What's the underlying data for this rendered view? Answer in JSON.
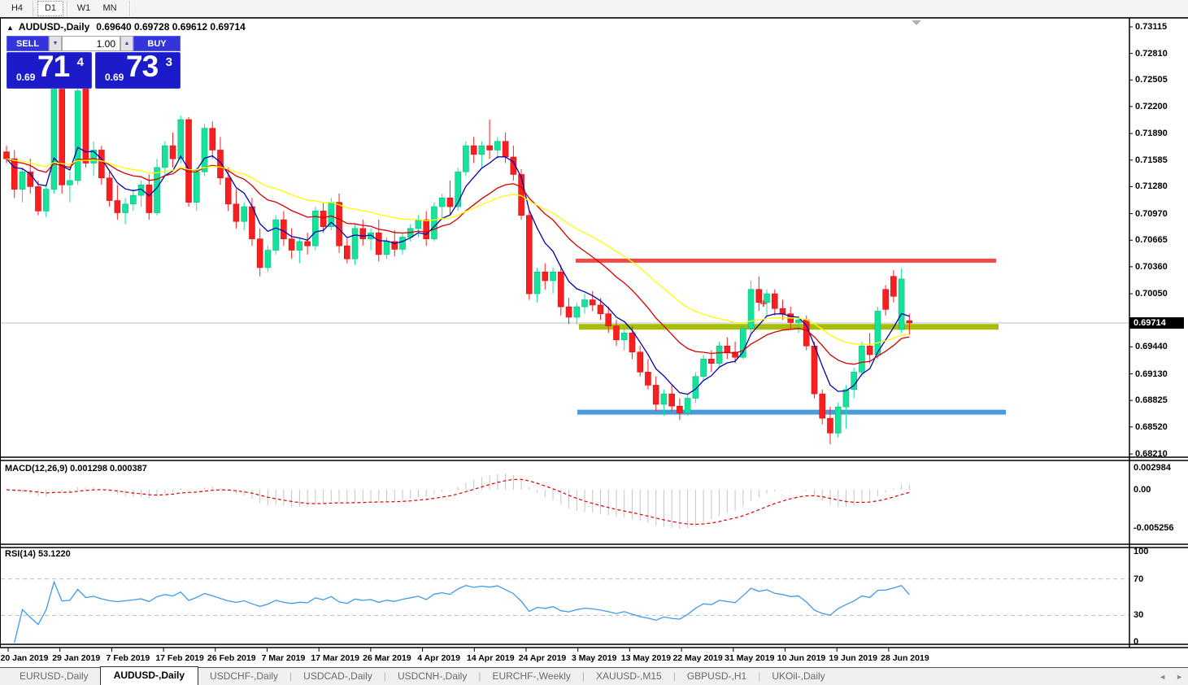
{
  "toolbar": {
    "timeframes": [
      {
        "label": "H4",
        "active": false
      },
      {
        "label": "D1",
        "active": true
      },
      {
        "label": "W1",
        "active": false
      },
      {
        "label": "MN",
        "active": false
      }
    ]
  },
  "chart_header": {
    "collapse_arrow": "▲",
    "title": "AUDUSD-,Daily",
    "ohlc": "0.69640 0.69728 0.69612 0.69714"
  },
  "trade_panel": {
    "sell_label": "SELL",
    "buy_label": "BUY",
    "volume": "1.00",
    "spin_down": "▼",
    "spin_up": "▲",
    "sell_price": {
      "small": "0.69",
      "big": "71",
      "sup": "4"
    },
    "buy_price": {
      "small": "0.69",
      "big": "73",
      "sup": "3"
    }
  },
  "price_axis": {
    "ticks": [
      {
        "label": "0.73115",
        "value": 0.73115
      },
      {
        "label": "0.72810",
        "value": 0.7281
      },
      {
        "label": "0.72505",
        "value": 0.72505
      },
      {
        "label": "0.72200",
        "value": 0.722
      },
      {
        "label": "0.71890",
        "value": 0.7189
      },
      {
        "label": "0.71585",
        "value": 0.71585
      },
      {
        "label": "0.71280",
        "value": 0.7128
      },
      {
        "label": "0.70970",
        "value": 0.7097
      },
      {
        "label": "0.70665",
        "value": 0.70665
      },
      {
        "label": "0.70360",
        "value": 0.7036
      },
      {
        "label": "0.70050",
        "value": 0.7005
      },
      {
        "label": "0.69440",
        "value": 0.6944
      },
      {
        "label": "0.69130",
        "value": 0.6913
      },
      {
        "label": "0.68825",
        "value": 0.68825
      },
      {
        "label": "0.68520",
        "value": 0.6852
      },
      {
        "label": "0.68210",
        "value": 0.6821
      }
    ],
    "current_price": "0.69714",
    "current_price_value": 0.69714
  },
  "date_axis": {
    "labels": [
      "20 Jan 2019",
      "29 Jan 2019",
      "7 Feb 2019",
      "17 Feb 2019",
      "26 Feb 2019",
      "7 Mar 2019",
      "17 Mar 2019",
      "26 Mar 2019",
      "4 Apr 2019",
      "14 Apr 2019",
      "24 Apr 2019",
      "3 May 2019",
      "13 May 2019",
      "22 May 2019",
      "31 May 2019",
      "10 Jun 2019",
      "19 Jun 2019",
      "28 Jun 2019"
    ]
  },
  "macd_panel": {
    "label": "MACD(12,26,9) 0.001298 0.000387",
    "ticks": [
      {
        "label": "0.002984",
        "value": 0.002984
      },
      {
        "label": "0.00",
        "value": 0
      },
      {
        "label": "-0.005256",
        "value": -0.005256
      }
    ]
  },
  "rsi_panel": {
    "label": "RSI(14) 53.1220",
    "ticks": [
      {
        "label": "100",
        "value": 100
      },
      {
        "label": "70",
        "value": 70
      },
      {
        "label": "30",
        "value": 30
      },
      {
        "label": "0",
        "value": 0
      }
    ]
  },
  "tabs": {
    "items": [
      {
        "label": "EURUSD-,Daily",
        "active": false
      },
      {
        "label": "AUDUSD-,Daily",
        "active": true
      },
      {
        "label": "USDCHF-,Daily",
        "active": false
      },
      {
        "label": "USDCAD-,Daily",
        "active": false
      },
      {
        "label": "USDCNH-,Daily",
        "active": false
      },
      {
        "label": "EURCHF-,Weekly",
        "active": false
      },
      {
        "label": "XAUUSD-,M15",
        "active": false
      },
      {
        "label": "GBPUSD-,H1",
        "active": false
      },
      {
        "label": "UKOil-,Daily",
        "active": false
      }
    ],
    "scroll_left": "◄",
    "scroll_right": "►"
  },
  "colors": {
    "bull": "#15e39b",
    "bull_border": "#0aba7d",
    "bear": "#f71f1f",
    "bear_border": "#d51212",
    "ma_fast": "#0000b4",
    "ma_medium": "#d40000",
    "ma_slow": "#ffff00",
    "line_resistance": "#f04a45",
    "line_pivot": "#a7bd07",
    "line_support": "#4a9bdc",
    "macd_hist": "#c4c4c4",
    "macd_signal": "#e00000",
    "rsi_line": "#3f9bea",
    "grid": "#c0c0c0",
    "marker_cross": "#e03030"
  },
  "chart_data": {
    "type": "candlestick",
    "symbol": "AUDUSD-",
    "timeframe": "Daily",
    "title": "AUDUSD-,Daily 0.69640 0.69728 0.69612 0.69714",
    "x_axis_labels": [
      "20 Jan 2019",
      "29 Jan 2019",
      "7 Feb 2019",
      "17 Feb 2019",
      "26 Feb 2019",
      "7 Mar 2019",
      "17 Mar 2019",
      "26 Mar 2019",
      "4 Apr 2019",
      "14 Apr 2019",
      "24 Apr 2019",
      "3 May 2019",
      "13 May 2019",
      "22 May 2019",
      "31 May 2019",
      "10 Jun 2019",
      "19 Jun 2019",
      "28 Jun 2019"
    ],
    "y_axis_range": [
      0.6821,
      0.73115
    ],
    "candles_ohlc": [
      [
        0.7168,
        0.7175,
        0.7155,
        0.716
      ],
      [
        0.716,
        0.717,
        0.7115,
        0.7125
      ],
      [
        0.7125,
        0.715,
        0.711,
        0.7145
      ],
      [
        0.7145,
        0.716,
        0.712,
        0.7128
      ],
      [
        0.7128,
        0.7135,
        0.7095,
        0.71
      ],
      [
        0.71,
        0.713,
        0.7093,
        0.7125
      ],
      [
        0.7125,
        0.7245,
        0.712,
        0.724
      ],
      [
        0.724,
        0.7252,
        0.712,
        0.713
      ],
      [
        0.713,
        0.7145,
        0.711,
        0.7135
      ],
      [
        0.7135,
        0.7258,
        0.713,
        0.7238
      ],
      [
        0.7244,
        0.7252,
        0.715,
        0.7155
      ],
      [
        0.7155,
        0.718,
        0.714,
        0.717
      ],
      [
        0.717,
        0.7175,
        0.713,
        0.7138
      ],
      [
        0.7138,
        0.7145,
        0.7105,
        0.7112
      ],
      [
        0.7112,
        0.713,
        0.709,
        0.7098
      ],
      [
        0.7098,
        0.7115,
        0.7085,
        0.7108
      ],
      [
        0.7108,
        0.7125,
        0.71,
        0.7118
      ],
      [
        0.7118,
        0.7135,
        0.7105,
        0.713
      ],
      [
        0.713,
        0.7142,
        0.709,
        0.7098
      ],
      [
        0.7098,
        0.716,
        0.7095,
        0.715
      ],
      [
        0.715,
        0.718,
        0.714,
        0.7175
      ],
      [
        0.7175,
        0.719,
        0.715,
        0.716
      ],
      [
        0.716,
        0.721,
        0.7155,
        0.7205
      ],
      [
        0.7205,
        0.7208,
        0.7105,
        0.711
      ],
      [
        0.711,
        0.715,
        0.71,
        0.7145
      ],
      [
        0.7145,
        0.72,
        0.714,
        0.7195
      ],
      [
        0.7195,
        0.7203,
        0.716,
        0.717
      ],
      [
        0.717,
        0.7185,
        0.713,
        0.7138
      ],
      [
        0.7138,
        0.715,
        0.71,
        0.7108
      ],
      [
        0.7108,
        0.7125,
        0.708,
        0.7088
      ],
      [
        0.7088,
        0.711,
        0.7078,
        0.7105
      ],
      [
        0.7105,
        0.7115,
        0.706,
        0.7068
      ],
      [
        0.7068,
        0.708,
        0.7025,
        0.7035
      ],
      [
        0.7035,
        0.706,
        0.703,
        0.7055
      ],
      [
        0.7055,
        0.7095,
        0.705,
        0.709
      ],
      [
        0.709,
        0.71,
        0.706,
        0.7068
      ],
      [
        0.7068,
        0.708,
        0.7045,
        0.7055
      ],
      [
        0.7055,
        0.707,
        0.704,
        0.7065
      ],
      [
        0.7065,
        0.7075,
        0.705,
        0.706
      ],
      [
        0.706,
        0.7105,
        0.7055,
        0.71
      ],
      [
        0.71,
        0.711,
        0.7075,
        0.7082
      ],
      [
        0.7082,
        0.7115,
        0.7078,
        0.711
      ],
      [
        0.711,
        0.712,
        0.7052,
        0.706
      ],
      [
        0.706,
        0.7068,
        0.704,
        0.7045
      ],
      [
        0.7045,
        0.7085,
        0.7038,
        0.708
      ],
      [
        0.708,
        0.709,
        0.706,
        0.7068
      ],
      [
        0.7068,
        0.708,
        0.7055,
        0.7075
      ],
      [
        0.7075,
        0.709,
        0.7042,
        0.705
      ],
      [
        0.705,
        0.707,
        0.7045,
        0.7065
      ],
      [
        0.7065,
        0.7078,
        0.7048,
        0.7056
      ],
      [
        0.7056,
        0.7075,
        0.705,
        0.707
      ],
      [
        0.707,
        0.7085,
        0.7065,
        0.708
      ],
      [
        0.708,
        0.7095,
        0.707,
        0.709
      ],
      [
        0.709,
        0.71,
        0.706,
        0.7068
      ],
      [
        0.7068,
        0.711,
        0.7065,
        0.7105
      ],
      [
        0.7105,
        0.712,
        0.709,
        0.7115
      ],
      [
        0.7115,
        0.7135,
        0.7095,
        0.7105
      ],
      [
        0.7105,
        0.715,
        0.71,
        0.7145
      ],
      [
        0.7145,
        0.718,
        0.714,
        0.7175
      ],
      [
        0.7175,
        0.7185,
        0.7155,
        0.7165
      ],
      [
        0.7165,
        0.718,
        0.715,
        0.7175
      ],
      [
        0.7175,
        0.7205,
        0.716,
        0.717
      ],
      [
        0.717,
        0.7185,
        0.716,
        0.718
      ],
      [
        0.718,
        0.719,
        0.7155,
        0.7162
      ],
      [
        0.7162,
        0.7175,
        0.7135,
        0.7142
      ],
      [
        0.7142,
        0.7148,
        0.709,
        0.7095
      ],
      [
        0.7095,
        0.71,
        0.6998,
        0.7005
      ],
      [
        0.7005,
        0.7035,
        0.6995,
        0.703
      ],
      [
        0.703,
        0.704,
        0.701,
        0.702
      ],
      [
        0.702,
        0.7035,
        0.7005,
        0.703
      ],
      [
        0.703,
        0.7038,
        0.698,
        0.699
      ],
      [
        0.699,
        0.7,
        0.697,
        0.6978
      ],
      [
        0.6978,
        0.6995,
        0.697,
        0.699
      ],
      [
        0.699,
        0.7005,
        0.6982,
        0.6998
      ],
      [
        0.6998,
        0.7008,
        0.6985,
        0.6992
      ],
      [
        0.6992,
        0.7,
        0.6975,
        0.6982
      ],
      [
        0.6982,
        0.699,
        0.696,
        0.6968
      ],
      [
        0.6968,
        0.6975,
        0.6945,
        0.6952
      ],
      [
        0.6952,
        0.6965,
        0.694,
        0.696
      ],
      [
        0.696,
        0.6968,
        0.693,
        0.6938
      ],
      [
        0.6938,
        0.6945,
        0.691,
        0.6915
      ],
      [
        0.6915,
        0.693,
        0.6895,
        0.69
      ],
      [
        0.69,
        0.691,
        0.687,
        0.6878
      ],
      [
        0.6878,
        0.6895,
        0.6865,
        0.689
      ],
      [
        0.689,
        0.69,
        0.687,
        0.6876
      ],
      [
        0.6876,
        0.6885,
        0.686,
        0.6868
      ],
      [
        0.6868,
        0.689,
        0.6865,
        0.6885
      ],
      [
        0.6885,
        0.6915,
        0.688,
        0.691
      ],
      [
        0.691,
        0.6935,
        0.6905,
        0.693
      ],
      [
        0.693,
        0.694,
        0.6915,
        0.6925
      ],
      [
        0.6925,
        0.695,
        0.692,
        0.6945
      ],
      [
        0.6945,
        0.6955,
        0.693,
        0.6938
      ],
      [
        0.6938,
        0.695,
        0.6925,
        0.6932
      ],
      [
        0.6932,
        0.697,
        0.693,
        0.6965
      ],
      [
        0.6965,
        0.702,
        0.696,
        0.701
      ],
      [
        0.701,
        0.7025,
        0.6985,
        0.6995
      ],
      [
        0.6995,
        0.701,
        0.698,
        0.7005
      ],
      [
        0.7005,
        0.701,
        0.698,
        0.6988
      ],
      [
        0.6988,
        0.6998,
        0.6975,
        0.6982
      ],
      [
        0.6982,
        0.699,
        0.6965,
        0.6972
      ],
      [
        0.6972,
        0.698,
        0.696,
        0.6975
      ],
      [
        0.6975,
        0.698,
        0.694,
        0.6945
      ],
      [
        0.6945,
        0.695,
        0.6885,
        0.689
      ],
      [
        0.689,
        0.6895,
        0.6855,
        0.6862
      ],
      [
        0.6862,
        0.6875,
        0.6832,
        0.6845
      ],
      [
        0.6845,
        0.688,
        0.684,
        0.6875
      ],
      [
        0.6875,
        0.69,
        0.685,
        0.6895
      ],
      [
        0.6895,
        0.692,
        0.6885,
        0.6915
      ],
      [
        0.6915,
        0.695,
        0.691,
        0.6945
      ],
      [
        0.6945,
        0.696,
        0.6925,
        0.6935
      ],
      [
        0.6935,
        0.699,
        0.693,
        0.6985
      ],
      [
        0.701,
        0.7015,
        0.698,
        0.6987
      ],
      [
        0.7025,
        0.7032,
        0.6995,
        0.7002
      ],
      [
        0.6964,
        0.7034,
        0.696,
        0.7022
      ],
      [
        0.6974,
        0.6982,
        0.6958,
        0.69714
      ]
    ],
    "horizontal_lines": [
      {
        "name": "resistance",
        "price": 0.7043,
        "color": "#f04a45",
        "thickness": 5
      },
      {
        "name": "pivot",
        "price": 0.6967,
        "color": "#a7bd07",
        "thickness": 7
      },
      {
        "name": "support",
        "price": 0.6869,
        "color": "#4a9bdc",
        "thickness": 6
      }
    ],
    "moving_averages": [
      {
        "name": "ema-fast-blue",
        "period": 6,
        "color": "#0000b4"
      },
      {
        "name": "ema-medium-red",
        "period": 18,
        "color": "#d40000"
      },
      {
        "name": "ema-slow-yellow",
        "period": 34,
        "color": "#ffff00"
      }
    ],
    "indicators": [
      {
        "type": "macd",
        "label": "MACD(12,26,9)",
        "values": [
          0.001298,
          0.000387
        ],
        "axis_ticks": [
          "0.002984",
          "0.00",
          "-0.005256"
        ]
      },
      {
        "type": "rsi",
        "label": "RSI(14)",
        "value": 53.122,
        "axis_ticks": [
          "100",
          "70",
          "30",
          "0"
        ],
        "levels": [
          70,
          30
        ]
      }
    ],
    "current_price": 0.69714
  }
}
